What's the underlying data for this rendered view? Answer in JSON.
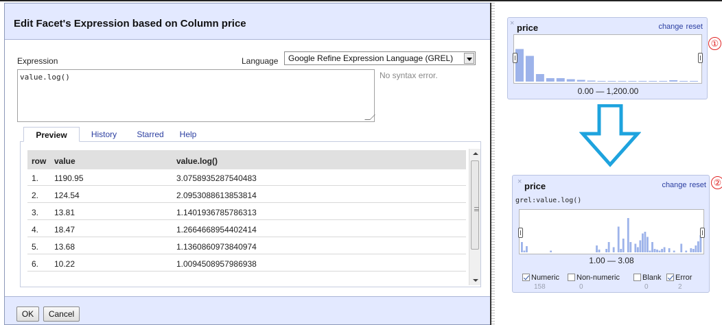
{
  "dialog": {
    "title": "Edit Facet's Expression based on Column price",
    "expression_label": "Expression",
    "language_label": "Language",
    "language_value": "Google Refine Expression Language (GREL)",
    "expression_value": "value.log()",
    "syntax_status": "No syntax error.",
    "tabs": [
      {
        "label": "Preview",
        "active": true
      },
      {
        "label": "History",
        "active": false
      },
      {
        "label": "Starred",
        "active": false
      },
      {
        "label": "Help",
        "active": false
      }
    ],
    "table": {
      "headers": [
        "row",
        "value",
        "value.log()"
      ],
      "rows": [
        {
          "row": "1.",
          "value": "1190.95",
          "result": "3.0758935287540483"
        },
        {
          "row": "2.",
          "value": "124.54",
          "result": "2.0953088613853814"
        },
        {
          "row": "3.",
          "value": "13.81",
          "result": "1.1401936785786313"
        },
        {
          "row": "4.",
          "value": "18.47",
          "result": "1.2664668954402414"
        },
        {
          "row": "5.",
          "value": "13.68",
          "result": "1.1360860973840974"
        },
        {
          "row": "6.",
          "value": "10.22",
          "result": "1.0094508957986938"
        }
      ]
    },
    "ok_label": "OK",
    "cancel_label": "Cancel"
  },
  "facet_before": {
    "close_glyph": "×",
    "title": "price",
    "change_label": "change",
    "reset_label": "reset",
    "range_text": "0.00 — 1,200.00",
    "callout": "①",
    "histogram_bars": [
      0.95,
      0.75,
      0.22,
      0.1,
      0.1,
      0.07,
      0.05,
      0.03,
      0.02,
      0.02,
      0.02,
      0.02,
      0.02,
      0.02,
      0.02,
      0.04,
      0.02,
      0.02
    ]
  },
  "arrow": {
    "color": "#1ea3de"
  },
  "facet_after": {
    "close_glyph": "×",
    "title": "price",
    "change_label": "change",
    "reset_label": "reset",
    "expression": "grel:value.log()",
    "range_text": "1.00 — 3.08",
    "callout": "②",
    "histogram_bars": [
      0.3,
      0.05,
      0.18,
      0,
      0,
      0,
      0,
      0,
      0,
      0,
      0,
      0,
      0.05,
      0,
      0,
      0,
      0,
      0,
      0,
      0,
      0,
      0,
      0,
      0,
      0,
      0,
      0,
      0,
      0,
      0,
      0,
      0.2,
      0.08,
      0,
      0,
      0.1,
      0.3,
      0,
      0.15,
      0,
      0.75,
      0.1,
      0.4,
      0,
      1.0,
      0.3,
      0,
      0.25,
      0.15,
      0.35,
      0.55,
      0.6,
      0.45,
      0.05,
      0.3,
      0.1,
      0.08,
      0.05,
      0.1,
      0.15,
      0,
      0.12,
      0,
      0.05,
      0,
      0,
      0.25,
      0,
      0.05,
      0,
      0.12,
      0.1,
      0.2,
      0.32,
      0.5
    ],
    "checks": [
      {
        "label": "Numeric",
        "count": "158",
        "checked": true
      },
      {
        "label": "Non-numeric",
        "count": "0",
        "checked": false
      },
      {
        "label": "Blank",
        "count": "0",
        "checked": false
      },
      {
        "label": "Error",
        "count": "2",
        "checked": true
      }
    ]
  },
  "colors": {
    "facet_bg": "#e3e9ff",
    "bar": "#9db3ea",
    "link": "#2b3ea0",
    "callout": "#e02020"
  }
}
